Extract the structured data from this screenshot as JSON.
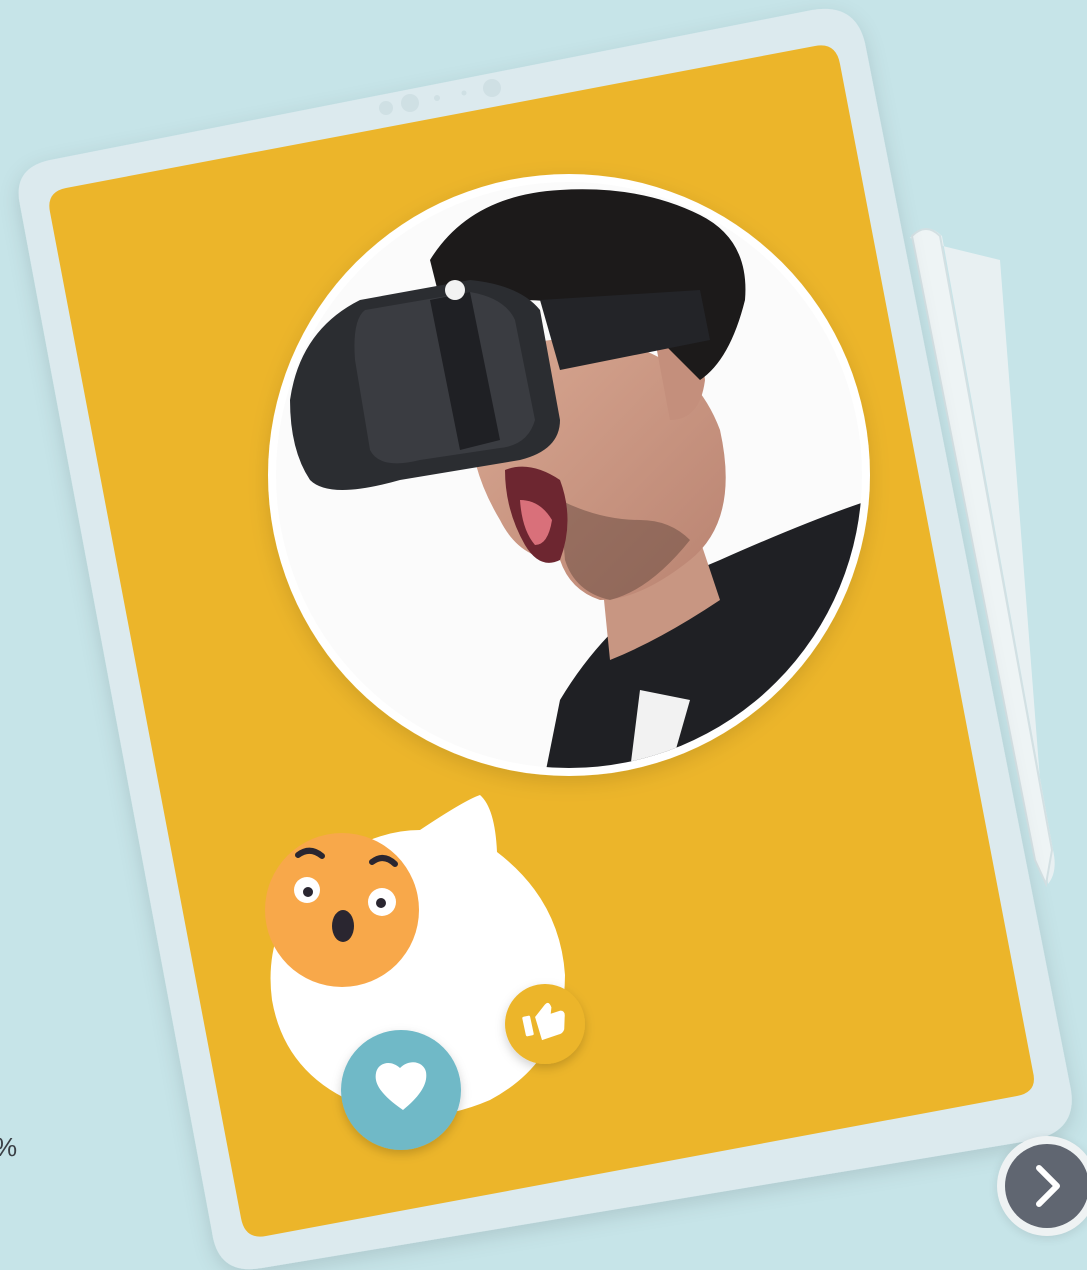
{
  "page": {
    "partial_text": "%"
  },
  "colors": {
    "background": "#c6e4e8",
    "tablet_frame": "#dceaee",
    "screen": "#ecb52a",
    "emoji_face": "#f8a84a",
    "heart_button": "#6fb9c7",
    "like_button": "#ecb52a",
    "next_button": "#606671"
  },
  "icons": {
    "reaction_emoji": "surprised-face-icon",
    "heart": "heart-icon",
    "like": "thumbs-up-icon",
    "next": "chevron-right-icon",
    "photo": "person-vr-headset-photo"
  }
}
